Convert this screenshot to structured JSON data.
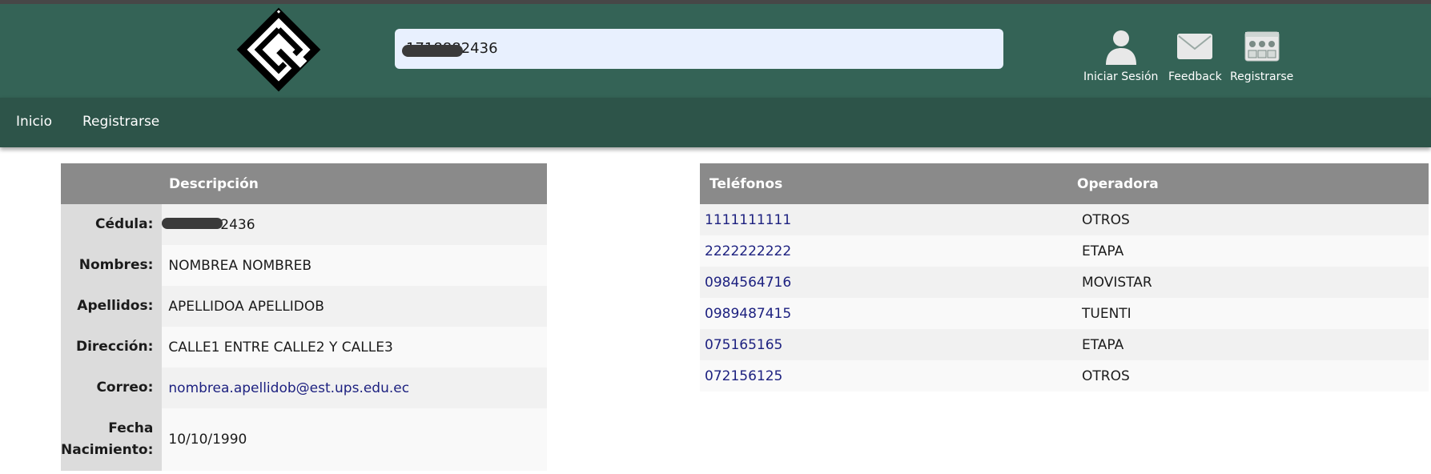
{
  "search": {
    "value": "1718882436"
  },
  "header_buttons": [
    {
      "label": "Iniciar Sesión",
      "icon": "user-icon"
    },
    {
      "label": "Feedback",
      "icon": "envelope-icon"
    },
    {
      "label": "Registrarse",
      "icon": "register-form-icon"
    }
  ],
  "nav": {
    "items": [
      "Inicio",
      "Registrarse"
    ]
  },
  "profile": {
    "header": "Descripción",
    "rows": [
      {
        "label": "Cédula:",
        "value": "1718882436"
      },
      {
        "label": "Nombres:",
        "value": "NOMBREA NOMBREB"
      },
      {
        "label": "Apellidos:",
        "value": "APELLIDOA APELLIDOB"
      },
      {
        "label": "Dirección:",
        "value": "CALLE1 ENTRE CALLE2 Y CALLE3"
      },
      {
        "label": "Correo:",
        "value": "nombrea.apellidob@est.ups.edu.ec"
      },
      {
        "label_line1": "Fecha",
        "label_line2": "Nacimiento:",
        "value": "10/10/1990"
      }
    ]
  },
  "phones": {
    "headers": [
      "Teléfonos",
      "Operadora"
    ],
    "rows": [
      {
        "number": "1111111111",
        "operator": "OTROS"
      },
      {
        "number": "2222222222",
        "operator": "ETAPA"
      },
      {
        "number": "0984564716",
        "operator": "MOVISTAR"
      },
      {
        "number": "0989487415",
        "operator": "TUENTI"
      },
      {
        "number": "075165165",
        "operator": "ETAPA"
      },
      {
        "number": "072156125",
        "operator": "OTROS"
      }
    ]
  },
  "colors": {
    "header_bg": "#346356",
    "navbar_bg": "#2d5449",
    "table_header_bg": "#8a8a8a",
    "link": "#1d2180"
  }
}
